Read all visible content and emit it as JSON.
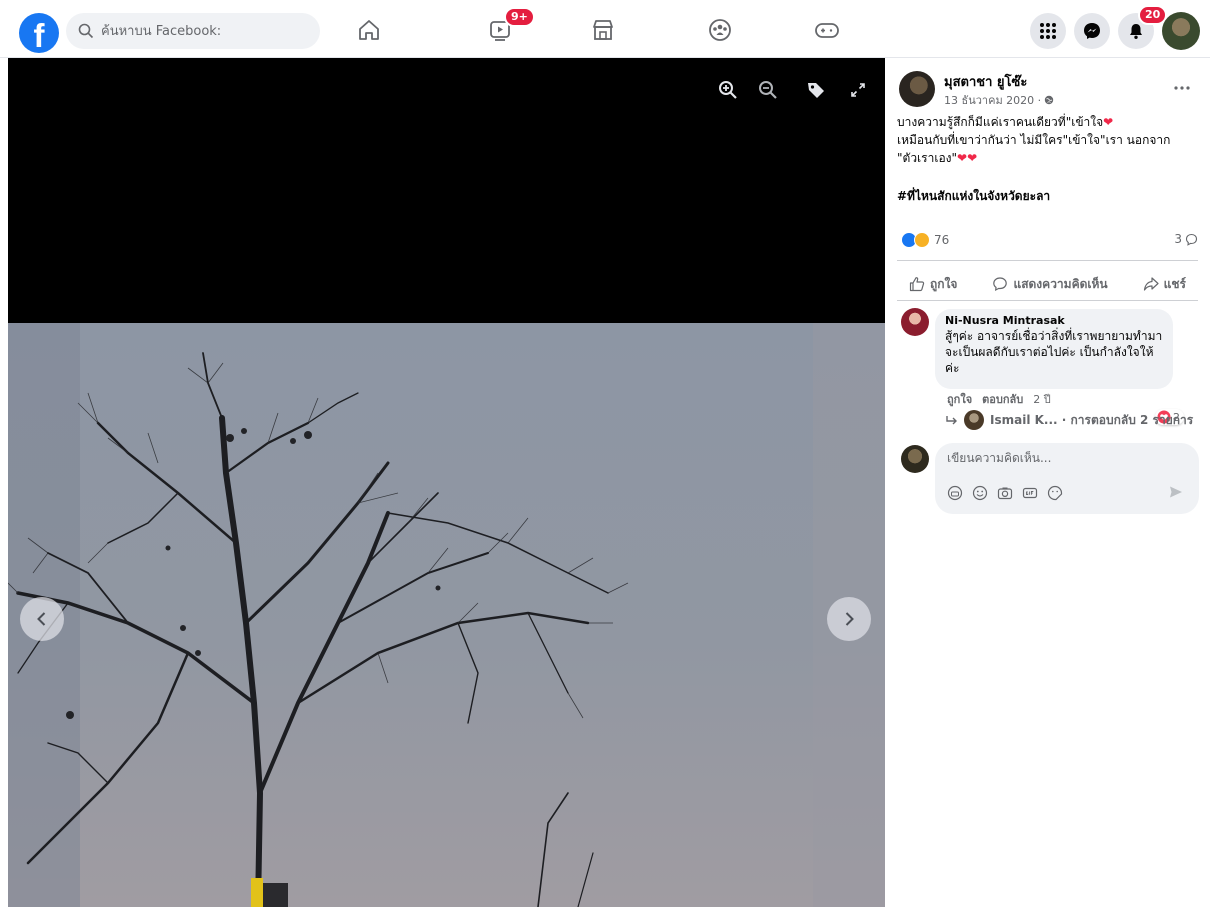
{
  "topbar": {
    "logo_letter": "f",
    "search_placeholder": "ค้นหาบน Facebook:",
    "watch_badge": "9+",
    "notifications_badge": "20",
    "colors": {
      "brand": "#1877f2",
      "badge": "#e41e3f"
    }
  },
  "viewer": {
    "tools": [
      "zoom-in-icon",
      "zoom-out-icon",
      "tag-icon",
      "fullscreen-icon"
    ]
  },
  "post": {
    "author": "มุสตาชา ยูโซ๊ะ",
    "date": "13 ธันวาคม 2020 ·",
    "text_lines": [
      "บางความรู้สึกก็มีแค่เราคนเดียวที่\"เข้าใจ",
      "เหมือนกับที่เขาว่ากันว่า ไม่มีใคร\"เข้าใจ\"เรา นอกจาก",
      "\"ตัวเราเอง\""
    ],
    "heart": "❤",
    "hashtag": "#ที่ไหนสักแห่งในจังหวัดยะลา",
    "reaction_count": "76",
    "comment_count": "3",
    "actions": {
      "like": "ถูกใจ",
      "comment": "แสดงความคิดเห็น",
      "share": "แชร์"
    }
  },
  "comment": {
    "author": "Ni-Nusra Mintrasak",
    "text": "สู้ๆค่ะ อาจารย์เชื่อว่าสิ่งที่เราพยายามทำมาจะเป็นผลดีกับเราต่อไปค่ะ เป็นกำลังใจให้ค่ะ",
    "reaction_count": "2",
    "like": "ถูกใจ",
    "reply": "ตอบกลับ",
    "age": "2 ปี",
    "replies": "Ismail K... · การตอบกลับ 2 รายการ"
  },
  "composer": {
    "placeholder": "เขียนความคิดเห็น..."
  }
}
